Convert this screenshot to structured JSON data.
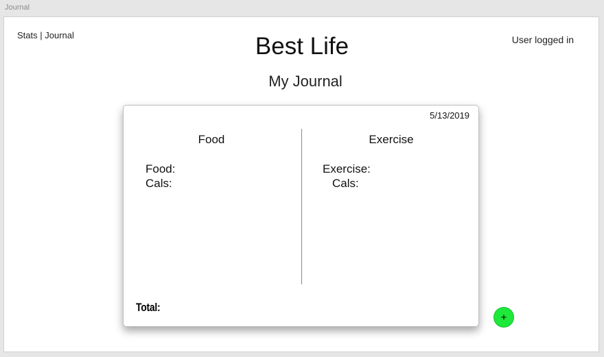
{
  "window": {
    "title": "Journal"
  },
  "nav": {
    "stats_label": "Stats",
    "separator": "|",
    "journal_label": "Journal"
  },
  "header": {
    "app_title": "Best Life",
    "user_status": "User logged in"
  },
  "page": {
    "subtitle": "My Journal"
  },
  "entry": {
    "date": "5/13/2019",
    "food": {
      "heading": "Food",
      "food_label": "Food:",
      "cals_label": "Cals:"
    },
    "exercise": {
      "heading": "Exercise",
      "exercise_label": "Exercise:",
      "cals_label": "Cals:"
    },
    "total_label": "Total:"
  },
  "actions": {
    "add_label": "+",
    "add_color": "#1ee83a"
  }
}
